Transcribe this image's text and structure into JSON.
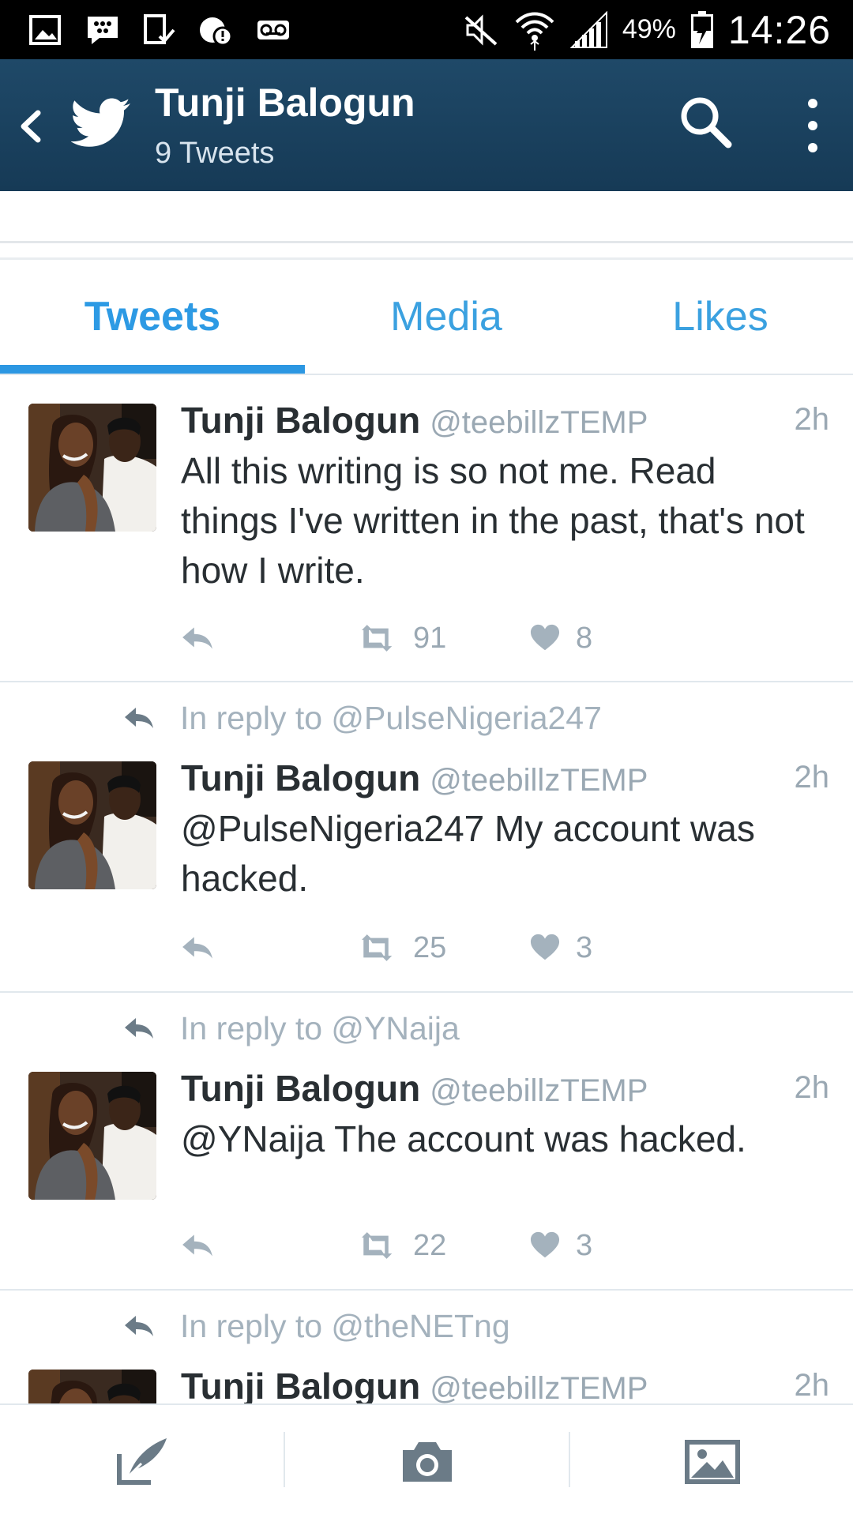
{
  "status_bar": {
    "battery_percent": "49%",
    "time": "14:26",
    "left_icons": [
      "gallery-icon",
      "bbm-icon",
      "device-check-icon",
      "alert-icon",
      "voicemail-icon"
    ],
    "right_icons": [
      "mute-icon",
      "wifi-icon",
      "signal-icon",
      "battery-charging-icon"
    ]
  },
  "app_bar": {
    "title": "Tunji Balogun",
    "subtitle": "9 Tweets",
    "icons": [
      "back-icon",
      "twitter-bird-icon",
      "search-icon",
      "more-vert-icon"
    ],
    "color": "#1d4565"
  },
  "tabs": [
    {
      "label": "Tweets",
      "active": true
    },
    {
      "label": "Media",
      "active": false
    },
    {
      "label": "Likes",
      "active": false
    }
  ],
  "accent_color": "#2c97e2",
  "tweets": [
    {
      "reply_to": "",
      "name": "Tunji Balogun",
      "handle": "@teebillzTEMP",
      "time": "2h",
      "text": "All this writing is so not me. Read things I've written in the past, that's not how I write.",
      "retweets": "91",
      "likes": "8"
    },
    {
      "reply_to": "In reply to @PulseNigeria247",
      "name": "Tunji Balogun",
      "handle": "@teebillzTEMP",
      "time": "2h",
      "text": "@PulseNigeria247 My account was hacked.",
      "retweets": "25",
      "likes": "3"
    },
    {
      "reply_to": "In reply to @YNaija",
      "name": "Tunji Balogun",
      "handle": "@teebillzTEMP",
      "time": "2h",
      "text": "@YNaija The account was hacked.",
      "retweets": "22",
      "likes": "3"
    },
    {
      "reply_to": "In reply to @theNETng",
      "name": "Tunji Balogun",
      "handle": "@teebillzTEMP",
      "time": "2h",
      "text": "",
      "retweets": "",
      "likes": ""
    }
  ],
  "bottom_bar": {
    "buttons": [
      "compose-tweet-icon",
      "camera-icon",
      "photo-gallery-icon"
    ]
  }
}
